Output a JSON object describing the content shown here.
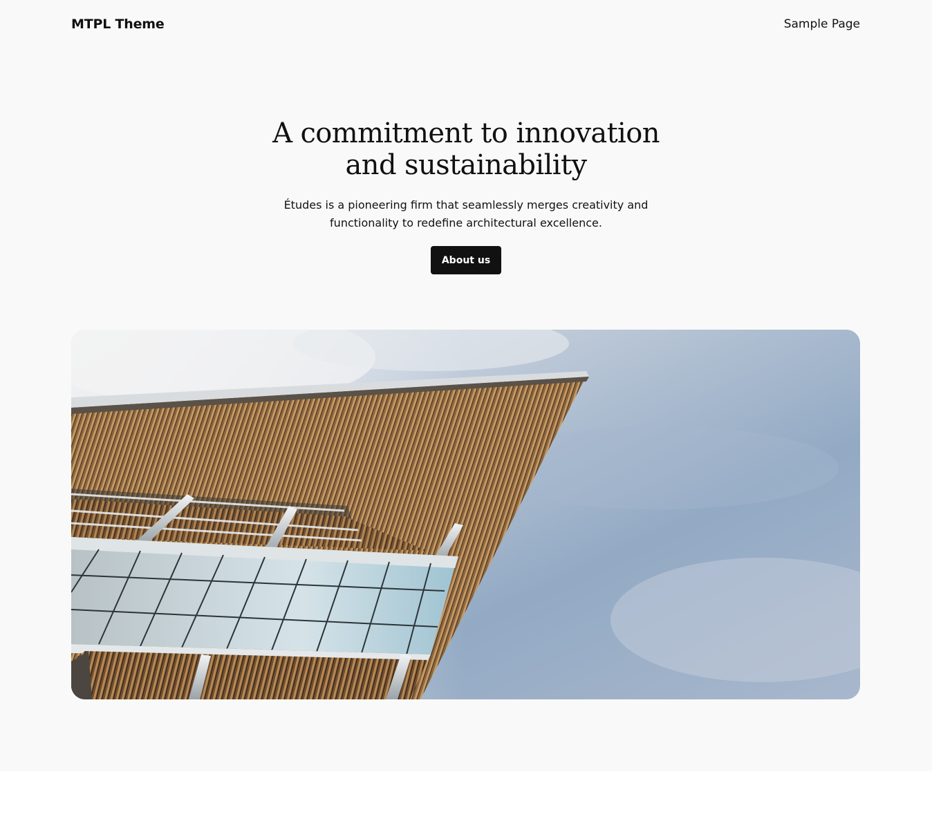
{
  "header": {
    "site_title": "MTPL Theme",
    "nav": [
      {
        "label": "Sample Page"
      }
    ]
  },
  "hero": {
    "title_line1": "A commitment to innovation",
    "title_line2": "and sustainability",
    "description": "Études is a pioneering firm that seamlessly merges creativity and functionality to redefine architectural excellence.",
    "cta_label": "About us"
  },
  "image": {
    "subject": "modern-building-canopy-photo"
  },
  "colors": {
    "background": "#f9f9f9",
    "text": "#111111",
    "button_bg": "#111111",
    "button_text": "#ffffff"
  }
}
